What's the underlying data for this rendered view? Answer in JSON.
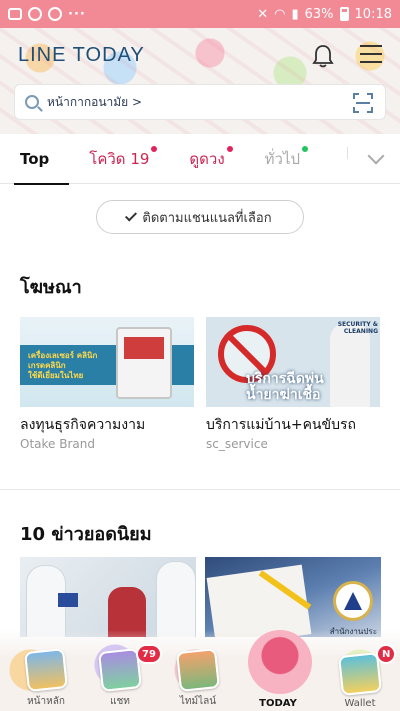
{
  "statusbar": {
    "battery": "63%",
    "time": "10:18"
  },
  "header": {
    "logo": "LINE TODAY",
    "search_placeholder": "หน้ากากอนามัย >"
  },
  "tabs": [
    {
      "label": "Top",
      "active": true
    },
    {
      "label": "โควิด 19",
      "dot_color": "#e0245e"
    },
    {
      "label": "ดูดวง",
      "dot_color": "#e0245e"
    },
    {
      "label": "ทั่วไป",
      "dot_color": "#22c55e"
    }
  ],
  "follow_channels": "ติดตามแชนแนลที่เลือก",
  "ads": {
    "title": "โฆษณา",
    "cards": [
      {
        "title": "ลงทุนธุรกิจความงาม",
        "source": "Otake Brand",
        "img_caption": "เครื่องเลเซอร์ คลินิก\nเกรดคลินิก\nใช้ดีเยี่ยมในไทย"
      },
      {
        "title": "บริการแม่บ้าน+คนขับรถ",
        "source": "sc_service",
        "img_caption": "บริการฉีดพ่น\nน้ำยาฆ่าเชื้อ",
        "img_badge": "SECURITY &\nCLEANING"
      }
    ]
  },
  "top_news": {
    "title": "10 ข่าวยอดนิยม",
    "image_label": "สำนักงานประ"
  },
  "bottomnav": [
    {
      "label": "หน้าหลัก"
    },
    {
      "label": "แชท",
      "badge": "79"
    },
    {
      "label": "ไทม์ไลน์"
    },
    {
      "label": "TODAY"
    },
    {
      "label": "Wallet",
      "badge": "N"
    }
  ]
}
